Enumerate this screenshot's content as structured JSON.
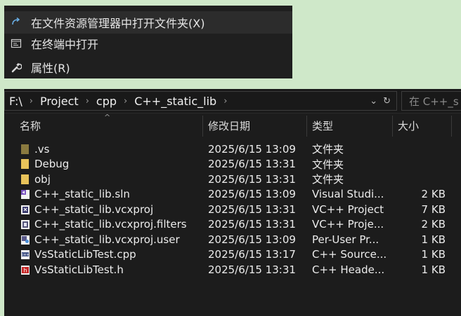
{
  "context_menu": {
    "items": [
      {
        "icon": "open-folder-arrow-icon",
        "label": "在文件资源管理器中打开文件夹(X)"
      },
      {
        "icon": "terminal-icon",
        "label": "在终端中打开"
      },
      {
        "icon": "wrench-icon",
        "label": "属性(R)"
      }
    ]
  },
  "explorer": {
    "breadcrumb": [
      "F:\\",
      "Project",
      "cpp",
      "C++_static_lib"
    ],
    "search_placeholder": "在 C++_s",
    "columns": {
      "name": "名称",
      "date": "修改日期",
      "type": "类型",
      "size": "大小"
    },
    "files": [
      {
        "icon": "folder-hidden-icon",
        "name": ".vs",
        "date": "2025/6/15 13:09",
        "type": "文件夹",
        "size": ""
      },
      {
        "icon": "folder-icon",
        "name": "Debug",
        "date": "2025/6/15 13:31",
        "type": "文件夹",
        "size": ""
      },
      {
        "icon": "folder-icon",
        "name": "obj",
        "date": "2025/6/15 13:31",
        "type": "文件夹",
        "size": ""
      },
      {
        "icon": "sln-file-icon",
        "name": "C++_static_lib.sln",
        "date": "2025/6/15 13:09",
        "type": "Visual Studi...",
        "size": "2 KB"
      },
      {
        "icon": "vcxproj-file-icon",
        "name": "C++_static_lib.vcxproj",
        "date": "2025/6/15 13:31",
        "type": "VC++ Project",
        "size": "7 KB"
      },
      {
        "icon": "filters-file-icon",
        "name": "C++_static_lib.vcxproj.filters",
        "date": "2025/6/15 13:31",
        "type": "VC++ Proje...",
        "size": "2 KB"
      },
      {
        "icon": "user-file-icon",
        "name": "C++_static_lib.vcxproj.user",
        "date": "2025/6/15 13:09",
        "type": "Per-User Pr...",
        "size": "1 KB"
      },
      {
        "icon": "cpp-file-icon",
        "name": "VsStaticLibTest.cpp",
        "date": "2025/6/15 13:17",
        "type": "C++ Source...",
        "size": "1 KB"
      },
      {
        "icon": "header-file-icon",
        "name": "VsStaticLibTest.h",
        "date": "2025/6/15 13:31",
        "type": "C++ Heade...",
        "size": "1 KB"
      }
    ]
  },
  "colors": {
    "page_background": "#cfe8c9",
    "menu_background": "#1f1f1f",
    "explorer_background": "#1c1c1c",
    "folder": "#e8c35a",
    "folder_hidden": "#8a7a3f"
  }
}
